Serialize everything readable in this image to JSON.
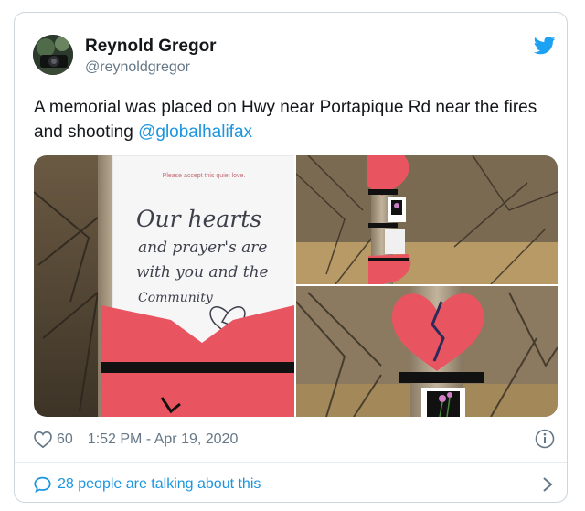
{
  "tweet": {
    "author_name": "Reynold Gregor",
    "author_handle": "@reynoldgregor",
    "text_plain": "A memorial was placed on Hwy near Portapique Rd near the fires and shooting ",
    "mention": "@globalhalifax",
    "like_count": "60",
    "timestamp": "1:52 PM - Apr 19, 2020",
    "conversation_text": "28 people are talking about this"
  },
  "media": {
    "note_header": "Please accept this quiet love.",
    "note_lines": [
      "Our hearts",
      "and prayer's are",
      "with you and the",
      "Community"
    ]
  },
  "colors": {
    "accent": "#1b95e0",
    "muted": "#657786",
    "heart_red": "#e8545f",
    "ribbon": "#111111"
  },
  "icons": [
    "twitter-bird-icon",
    "heart-icon",
    "info-icon",
    "speech-bubble-icon",
    "chevron-right-icon"
  ]
}
